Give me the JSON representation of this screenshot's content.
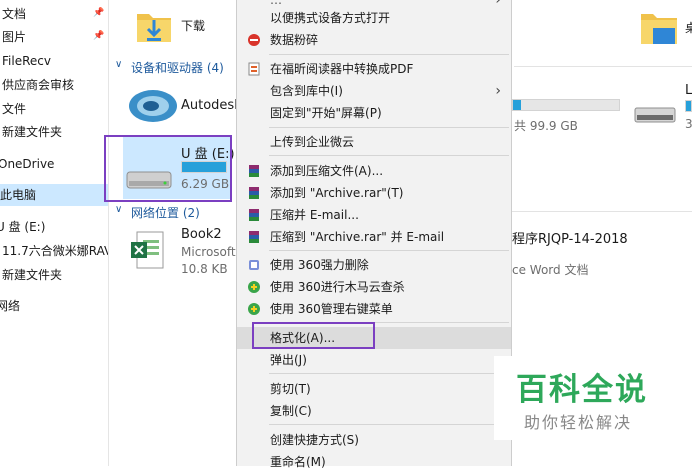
{
  "sidebar": {
    "items": [
      {
        "label": "文档",
        "pinned": true
      },
      {
        "label": "图片",
        "pinned": true
      },
      {
        "label": "FileRecv"
      },
      {
        "label": "供应商会审核"
      },
      {
        "label": "文件"
      },
      {
        "label": "新建文件夹"
      },
      {
        "label": "OneDrive"
      },
      {
        "label": "此电脑",
        "selected": true
      },
      {
        "label": "U 盘 (E:)"
      },
      {
        "label": "11.7六合微米娜RAV"
      },
      {
        "label": "新建文件夹"
      },
      {
        "label": "网络"
      }
    ]
  },
  "main": {
    "downloads_label": "下载",
    "devices_header": "设备和驱动器 (4)",
    "drives": [
      {
        "name": "Autodesk",
        "free": ""
      },
      {
        "name": "U 盘 (E:)",
        "free": "6.29 GB",
        "used_fraction": 0.62
      },
      {
        "name": "",
        "free": "共 99.9 GB",
        "used_fraction": 0.7
      },
      {
        "name": "L",
        "free": "3"
      }
    ],
    "network_header": "网络位置 (2)",
    "network": [
      {
        "name": "Book2",
        "type": "Microsoft",
        "size": "10.8 KB"
      },
      {
        "name": "程序RJQP-14-2018",
        "type": "ce Word 文档"
      }
    ],
    "right_top_label": "桌"
  },
  "context_menu": {
    "items": [
      {
        "label": "以便携式设备方式打开",
        "icon": ""
      },
      {
        "label": "数据粉碎",
        "icon": "shred-icon"
      },
      {
        "label": "在福昕阅读器中转换成PDF",
        "icon": "pdf-icon"
      },
      {
        "label": "包含到库中(I)",
        "submenu": true
      },
      {
        "label": "固定到\"开始\"屏幕(P)"
      },
      {
        "label": "上传到企业微云"
      },
      {
        "label": "添加到压缩文件(A)...",
        "icon": "rar-icon"
      },
      {
        "label": "添加到 \"Archive.rar\"(T)",
        "icon": "rar-icon"
      },
      {
        "label": "压缩并 E-mail...",
        "icon": "rar-icon"
      },
      {
        "label": "压缩到 \"Archive.rar\" 并 E-mail",
        "icon": "rar-icon"
      },
      {
        "label": "使用 360强力删除",
        "icon": "360-delete-icon"
      },
      {
        "label": "使用 360进行木马云查杀",
        "icon": "360-scan-icon"
      },
      {
        "label": "使用 360管理右键菜单",
        "icon": "360-menu-icon"
      },
      {
        "label": "格式化(A)...",
        "highlighted": true
      },
      {
        "label": "弹出(J)"
      },
      {
        "label": "剪切(T)"
      },
      {
        "label": "复制(C)"
      },
      {
        "label": "创建快捷方式(S)"
      },
      {
        "label": "重命名(M)"
      }
    ]
  },
  "watermark": {
    "title": "百科全说",
    "subtitle": "助你轻松解决"
  },
  "colors": {
    "accent": "#26a0da",
    "selection": "#cce8ff",
    "highlight_box": "#7b3fc1",
    "watermark": "#2ea85a"
  }
}
